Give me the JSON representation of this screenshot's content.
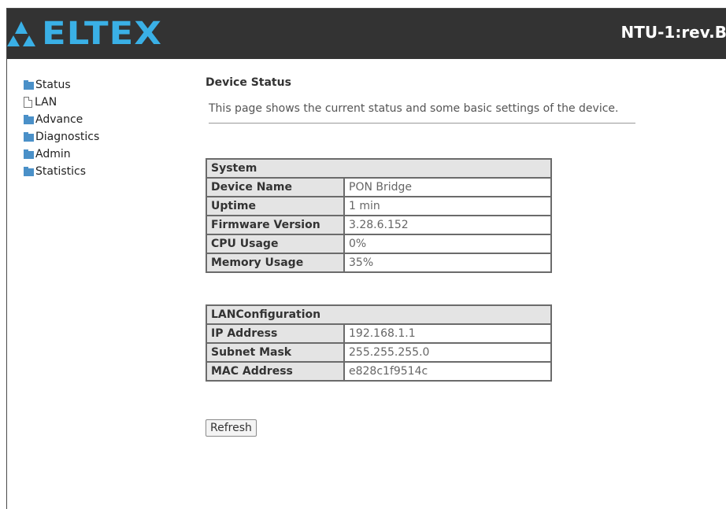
{
  "header": {
    "logo_text": "ELTEX",
    "device_title": "NTU-1:rev.B"
  },
  "nav": {
    "items": [
      {
        "label": "Status",
        "icon": "folder-icon"
      },
      {
        "label": "LAN",
        "icon": "document-icon"
      },
      {
        "label": "Advance",
        "icon": "folder-icon"
      },
      {
        "label": "Diagnostics",
        "icon": "folder-icon"
      },
      {
        "label": "Admin",
        "icon": "folder-icon"
      },
      {
        "label": "Statistics",
        "icon": "folder-icon"
      }
    ]
  },
  "main": {
    "title": "Device Status",
    "description": "This page shows the current status and some basic settings of the device.",
    "system": {
      "header": "System",
      "rows": [
        {
          "label": "Device Name",
          "value": "PON Bridge"
        },
        {
          "label": "Uptime",
          "value": "1 min"
        },
        {
          "label": "Firmware Version",
          "value": "3.28.6.152"
        },
        {
          "label": "CPU Usage",
          "value": "0%"
        },
        {
          "label": "Memory Usage",
          "value": "35%"
        }
      ]
    },
    "lan": {
      "header": "LANConfiguration",
      "rows": [
        {
          "label": "IP Address",
          "value": "192.168.1.1"
        },
        {
          "label": "Subnet Mask",
          "value": "255.255.255.0"
        },
        {
          "label": "MAC Address",
          "value": "e828c1f9514c"
        }
      ]
    },
    "refresh_label": "Refresh"
  },
  "colors": {
    "header_bg": "#333333",
    "logo_blue": "#3ab0e6",
    "table_header_bg": "#e4e4e4",
    "folder_blue": "#4a90c8"
  }
}
